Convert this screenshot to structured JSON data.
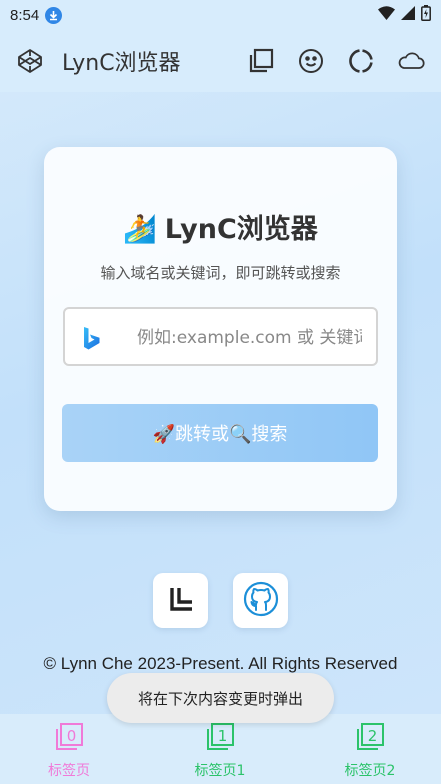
{
  "status_bar": {
    "time": "8:54"
  },
  "app_bar": {
    "title": "LynC浏览器",
    "icons": [
      "codepen-icon",
      "copy-icon",
      "smiley-icon",
      "loading-ring-icon",
      "cloud-icon"
    ]
  },
  "card": {
    "emoji": "🏄",
    "title": "LynC浏览器",
    "subtitle": "输入域名或关键词，即可跳转或搜索",
    "search_placeholder": "例如:example.com 或 关键词",
    "search_engine_icon": "bing-icon",
    "button_label": "🚀跳转或🔍搜索"
  },
  "links": {
    "icons": [
      "l-logo-icon",
      "github-icon"
    ]
  },
  "footer": {
    "copyright": "© Lynn Che 2023-Present. All Rights Reserved"
  },
  "toast": {
    "text": "将在下次内容变更时弹出"
  },
  "tabs": [
    {
      "number": "0",
      "label": "标签页",
      "color": "#f07ad8"
    },
    {
      "number": "1",
      "label": "标签页1",
      "color": "#2cc36a"
    },
    {
      "number": "2",
      "label": "标签页2",
      "color": "#2cc36a"
    }
  ]
}
